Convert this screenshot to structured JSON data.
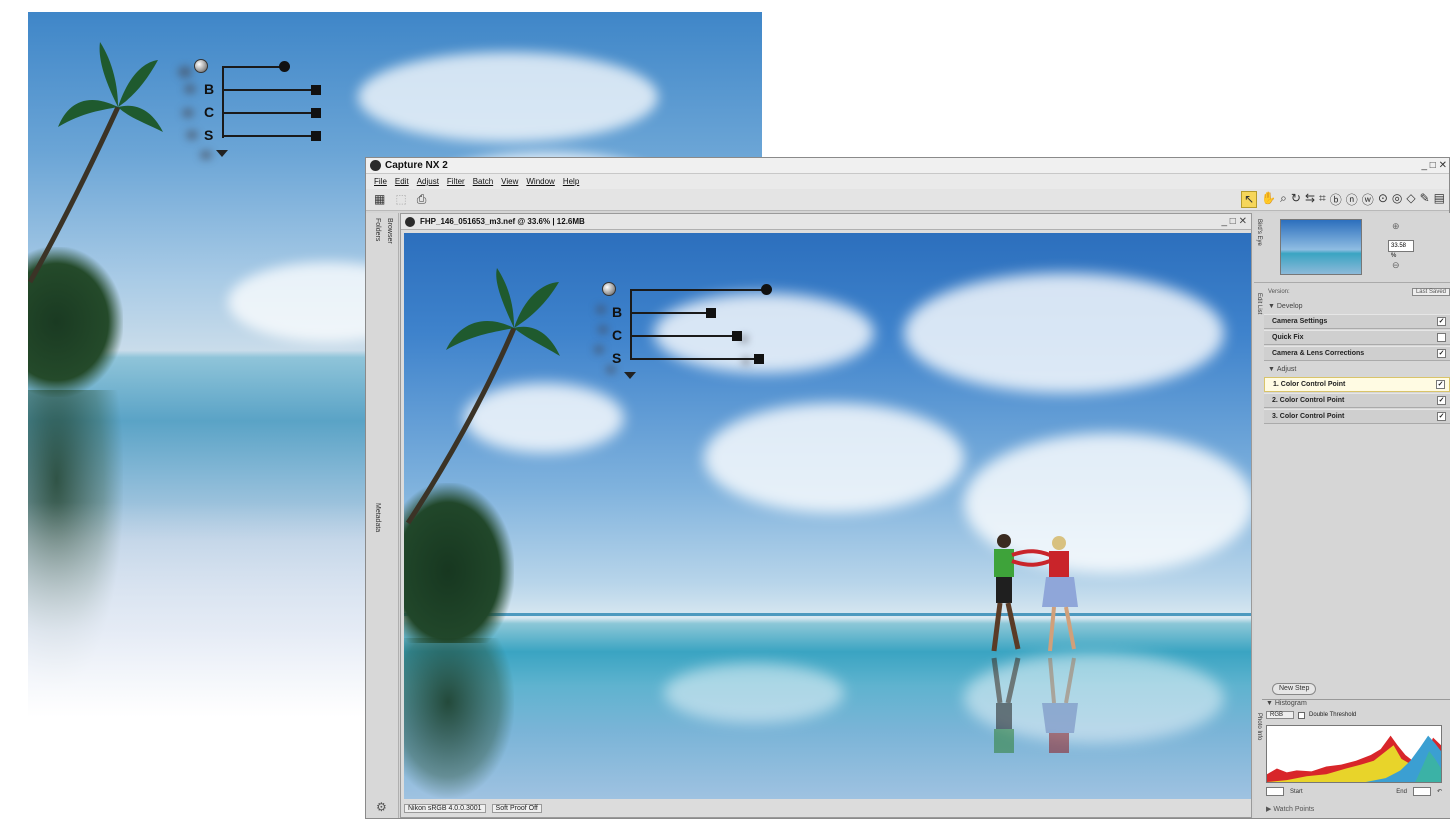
{
  "app": {
    "title": "Capture NX 2",
    "window_controls": "_ □ ✕"
  },
  "menu": [
    "File",
    "Edit",
    "Adjust",
    "Filter",
    "Batch",
    "View",
    "Window",
    "Help"
  ],
  "left_strip": {
    "tabs": [
      "Folders",
      "Browser",
      "Metadata"
    ]
  },
  "document": {
    "title": "FHP_146_051653_m3.nef @ 33.6% | 12.6MB",
    "window_controls": "_ □ ✕"
  },
  "overlay": {
    "labels": [
      "B",
      "C",
      "S"
    ]
  },
  "statusbar": {
    "profile": "Nikon sRGB 4.0.0.3001",
    "proof": "Soft Proof Off"
  },
  "birds_eye": {
    "label": "Bird's Eye",
    "zoom": "33.58 %"
  },
  "edit_list": {
    "label": "Edit List",
    "version_label": "Version:",
    "version_value": "Last Saved",
    "develop_heading": "Develop",
    "develop_items": [
      {
        "label": "Camera Settings",
        "checked": true
      },
      {
        "label": "Quick Fix",
        "checked": false
      },
      {
        "label": "Camera & Lens Corrections",
        "checked": true
      }
    ],
    "adjust_heading": "Adjust",
    "adjust_items": [
      {
        "label": "1. Color Control Point",
        "checked": true,
        "selected": true
      },
      {
        "label": "2. Color Control Point",
        "checked": true,
        "selected": false
      },
      {
        "label": "3. Color Control Point",
        "checked": true,
        "selected": false
      }
    ],
    "new_step": "New Step"
  },
  "histogram": {
    "title": "Histogram",
    "channel": "RGB",
    "double_threshold": "Double Threshold",
    "start": "Start",
    "end": "End",
    "photo_info_label": "Photo Info"
  },
  "watch_points": "Watch Points",
  "colors": {
    "accent_yellow": "#f6d65a",
    "selected_step_bg": "#fffbe3"
  }
}
